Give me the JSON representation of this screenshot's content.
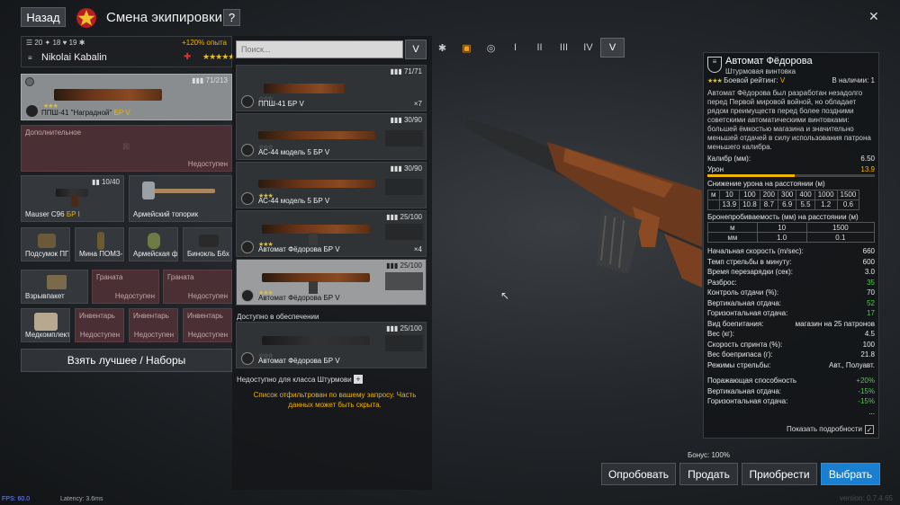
{
  "header": {
    "back_label": "Назад",
    "title": "Смена экипировки",
    "help_label": "?",
    "close_label": "✕"
  },
  "soldier": {
    "stat1": "20",
    "stat2": "18",
    "stat3": "19",
    "xp_bonus": "+120% опыта",
    "name": "Nikolai Kabalin",
    "rank_stars": "★★★★★"
  },
  "primary": {
    "name": "ППШ-41 \"Наградной\"",
    "br": "БР V",
    "ammo": "71/213"
  },
  "secondary": {
    "label": "Дополнительное",
    "unavailable": "Недоступен"
  },
  "sidearm": {
    "name": "Mauser C96",
    "br": "БР I",
    "ammo": "10/40"
  },
  "melee": {
    "name": "Армейский топорик"
  },
  "equipment": [
    {
      "name": "Подсумок ПГ"
    },
    {
      "name": "Мина ПОМЗ-"
    },
    {
      "name": "Армейская ф"
    },
    {
      "name": "Бинокль Б6х"
    }
  ],
  "grenades": [
    {
      "name": "Взрывпакет",
      "category": "",
      "unavailable": ""
    },
    {
      "name": "",
      "category": "Граната",
      "unavailable": "Недоступен"
    },
    {
      "name": "",
      "category": "Граната",
      "unavailable": "Недоступен"
    }
  ],
  "inventory": [
    {
      "name": "Медкомплект",
      "category": "",
      "unavailable": ""
    },
    {
      "name": "",
      "category": "Инвентарь",
      "unavailable": "Недоступен"
    },
    {
      "name": "",
      "category": "Инвентарь",
      "unavailable": "Недоступен"
    },
    {
      "name": "",
      "category": "Инвентарь",
      "unavailable": "Недоступен"
    }
  ],
  "best_button": "Взять лучшее / Наборы",
  "search": {
    "placeholder": "Поиск...",
    "filter_label": "V"
  },
  "weapons": [
    {
      "name": "ППШ-41",
      "br": "БР V",
      "ammo": "71/71",
      "count": "×7"
    },
    {
      "name": "АС-44 модель 5",
      "br": "БР V",
      "ammo": "30/90",
      "count": ""
    },
    {
      "name": "АС-44 модель 5",
      "br": "БР V",
      "ammo": "30/90",
      "count": ""
    },
    {
      "name": "Автомат Фёдорова",
      "br": "БР V",
      "ammo": "25/100",
      "count": "×4"
    },
    {
      "name": "Автомат Фёдорова",
      "br": "БР V",
      "ammo": "25/100",
      "count": ""
    }
  ],
  "supply_label": "Доступно в обеспечении",
  "supply_weapon": {
    "name": "Автомат Фёдорова",
    "br": "БР V",
    "ammo": "25/100"
  },
  "unavailable_class": "Недоступно для класса Штурмови",
  "filter_note": "Список отфильтрован по вашему запросу. Часть данных может быть скрыта.",
  "tabs": [
    "✱",
    "▣",
    "◎",
    "I",
    "II",
    "III",
    "IV",
    "V"
  ],
  "info": {
    "title": "Автомат Фёдорова",
    "subtitle": "Штурмовая винтовка",
    "rating_label": "Боевой рейтинг:",
    "rating_value": "V",
    "stock_label": "В наличии:",
    "stock_value": "1",
    "description": "Автомат Фёдорова был разработан незадолго перед Первой мировой войной, но обладает рядом преимуществ перед более поздними советскими автоматическими винтовками: большей ёмкостью магазина и значительно меньшей отдачей в силу использования патрона меньшего калибра.",
    "caliber_label": "Калибр (мм):",
    "caliber": "6.50",
    "damage_label": "Урон",
    "damage": "13.9",
    "damage_fill": 0.52,
    "falloff_label": "Снижение урона на расстоянии (м)",
    "falloff_m": [
      "м",
      "10",
      "100",
      "200",
      "300",
      "400",
      "1000",
      "1500"
    ],
    "falloff_v": [
      "",
      "13.9",
      "10.8",
      "8.7",
      "6.9",
      "5.5",
      "1.2",
      "0.6"
    ],
    "pen_label": "Бронепробиваемость (мм) на расстоянии (м)",
    "pen_m": [
      "м",
      "10",
      "1500"
    ],
    "pen_v": [
      "мм",
      "1.0",
      "0.1"
    ],
    "stats": [
      {
        "k": "Начальная скорость (m/sec):",
        "v": "660",
        "c": ""
      },
      {
        "k": "Темп стрельбы в минуту:",
        "v": "600",
        "c": ""
      },
      {
        "k": "Время перезарядки (сек):",
        "v": "3.0",
        "c": ""
      },
      {
        "k": "Разброс:",
        "v": "35",
        "c": "grn"
      },
      {
        "k": "Контроль отдачи (%):",
        "v": "70",
        "c": ""
      },
      {
        "k": "Вертикальная отдача:",
        "v": "52",
        "c": "grn"
      },
      {
        "k": "Горизонтальная отдача:",
        "v": "17",
        "c": "grn"
      },
      {
        "k": "Вид боепитания:",
        "v": "магазин на 25 патронов",
        "c": ""
      },
      {
        "k": "Вес (кг):",
        "v": "4.5",
        "c": ""
      },
      {
        "k": "Скорость спринта (%):",
        "v": "100",
        "c": ""
      },
      {
        "k": "Вес боеприпаса (г):",
        "v": "21.8",
        "c": ""
      },
      {
        "k": "Режимы стрельбы:",
        "v": "Авт., Полуавт.",
        "c": ""
      }
    ],
    "mods": [
      {
        "k": "Поражающая способность",
        "v": "+20%"
      },
      {
        "k": "Вертикальная отдача:",
        "v": "-15%"
      },
      {
        "k": "Горизонтальная отдача:",
        "v": "-15%"
      }
    ],
    "more": "...",
    "details_label": "Показать подробности",
    "details_checked": "✓"
  },
  "bonus": "Бонус: 100%",
  "actions": {
    "try": "Опробовать",
    "sell": "Продать",
    "buy": "Приобрести",
    "select": "Выбрать"
  },
  "footer": {
    "fps": "FPS: 60.0",
    "latency": "Latency: 3.6ms",
    "version": "version: 0.7.4.65"
  },
  "colors": {
    "accent": "#1b7fd0",
    "br": "#f0b400",
    "positive": "#4ad04a"
  }
}
